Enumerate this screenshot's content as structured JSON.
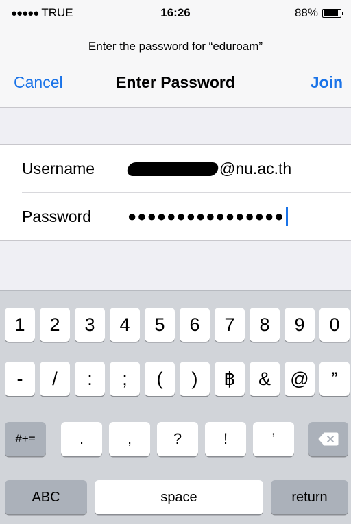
{
  "status_bar": {
    "signal_dots": "●●●●●",
    "carrier": "TRUE",
    "time": "16:26",
    "battery_percent": "88%",
    "battery_level": 0.88
  },
  "header": {
    "prompt": "Enter the password for “eduroam”",
    "cancel_label": "Cancel",
    "title": "Enter Password",
    "join_label": "Join"
  },
  "form": {
    "username_label": "Username",
    "username_suffix": "@nu.ac.th",
    "password_label": "Password",
    "password_mask": "●●●●●●●●●●●●●●●●"
  },
  "keyboard": {
    "row1": [
      "1",
      "2",
      "3",
      "4",
      "5",
      "6",
      "7",
      "8",
      "9",
      "0"
    ],
    "row2": [
      "-",
      "/",
      ":",
      ";",
      "(",
      ")",
      "฿",
      "&",
      "@",
      "”"
    ],
    "row3": {
      "symbols_label": "#+=",
      "keys": [
        ".",
        ",",
        "?",
        "!",
        "’"
      ],
      "delete_icon": "backspace-icon"
    },
    "row4": {
      "abc_label": "ABC",
      "space_label": "space",
      "return_label": "return"
    }
  },
  "colors": {
    "accent": "#1a73e8",
    "keyboard_bg": "#d1d4d9",
    "dark_key": "#abb1ba"
  }
}
